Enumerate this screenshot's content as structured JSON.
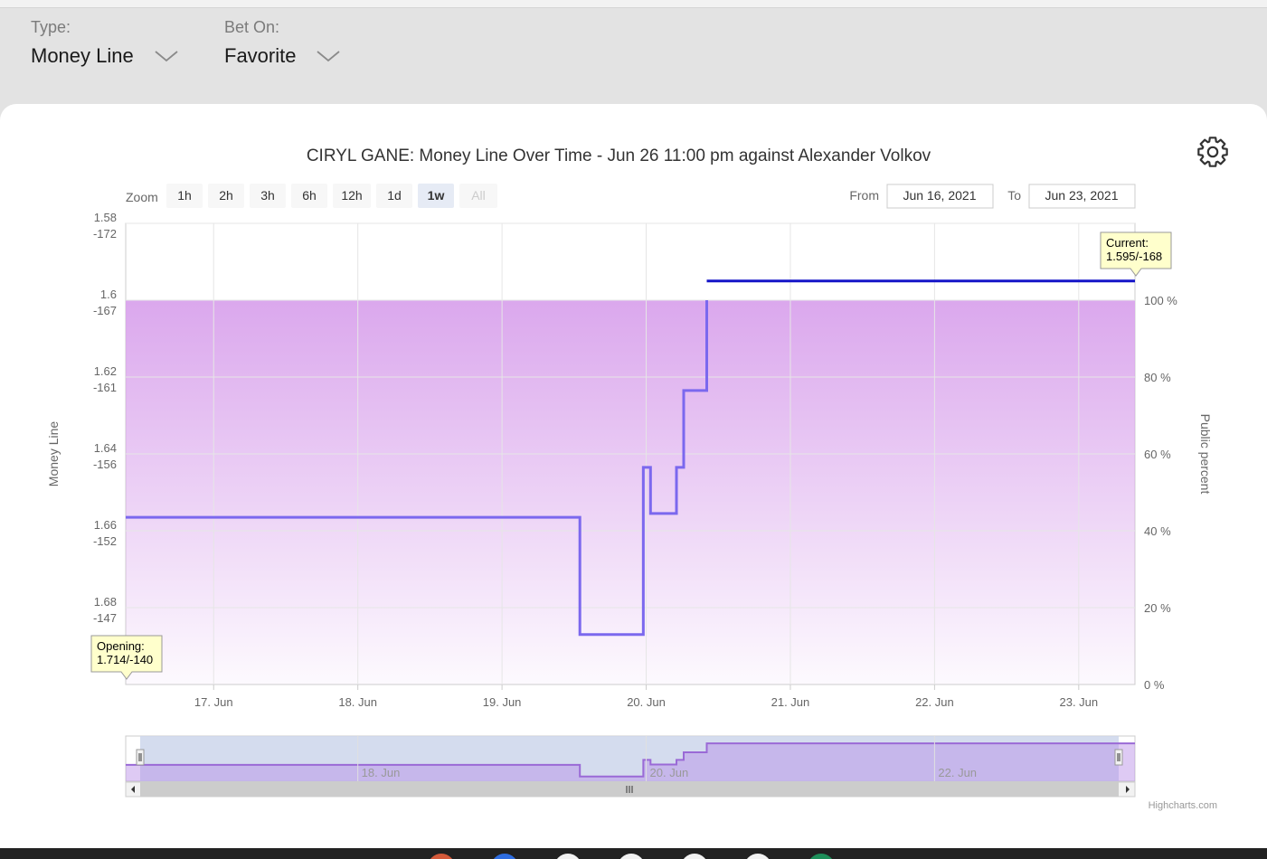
{
  "filters": {
    "type": {
      "label": "Type:",
      "value": "Money Line"
    },
    "bet_on": {
      "label": "Bet On:",
      "value": "Favorite"
    }
  },
  "chart_data": {
    "type": "line",
    "title": "CIRYL GANE: Money Line Over Time - Jun 26 11:00 pm against Alexander Volkov",
    "ylabel": "Money Line",
    "y2label": "Public percent",
    "x_ticks": [
      "17. Jun",
      "18. Jun",
      "19. Jun",
      "20. Jun",
      "21. Jun",
      "22. Jun",
      "23. Jun"
    ],
    "x_range_days": [
      16.39,
      23.39
    ],
    "y_range_decimal": [
      1.7,
      1.58
    ],
    "y_ticks": [
      {
        "decimal": 1.58,
        "american": "-172"
      },
      {
        "decimal": 1.6,
        "american": "-167"
      },
      {
        "decimal": 1.62,
        "american": "-161"
      },
      {
        "decimal": 1.64,
        "american": "-156"
      },
      {
        "decimal": 1.66,
        "american": "-152"
      },
      {
        "decimal": 1.68,
        "american": "-147"
      }
    ],
    "y2_ticks": [
      "100 %",
      "80 %",
      "60 %",
      "40 %",
      "20 %",
      "0 %"
    ],
    "y2_range": [
      0,
      120
    ],
    "series": [
      {
        "color": "#7b68ee",
        "step": true,
        "x": [
          16.39,
          19.54,
          19.98,
          20.03,
          20.21,
          20.26,
          20.42
        ],
        "y": [
          1.6565,
          1.687,
          1.6435,
          1.6555,
          1.6435,
          1.6235,
          1.6
        ]
      },
      {
        "color": "#1515c8",
        "step": true,
        "x": [
          20.42,
          23.39
        ],
        "y": [
          1.595,
          1.595
        ]
      }
    ],
    "public_percent_area": {
      "value": 100,
      "color": "#d9a3ec"
    },
    "annotations": {
      "opening": {
        "line1": "Opening:",
        "line2": "1.714/-140"
      },
      "current": {
        "line1": "Current:",
        "line2": "1.595/-168"
      }
    },
    "range_selector": {
      "zoom_label": "Zoom",
      "buttons": [
        "1h",
        "2h",
        "3h",
        "6h",
        "12h",
        "1d",
        "1w",
        "All"
      ],
      "selected": "1w",
      "disabled": "All",
      "from_label": "From",
      "from_value": "Jun 16, 2021",
      "to_label": "To",
      "to_value": "Jun 23, 2021"
    },
    "navigator_ticks": [
      "18. Jun",
      "20. Jun",
      "22. Jun"
    ],
    "credit": "Highcharts.com"
  },
  "icons": {
    "settings": "gear-icon",
    "dropdown": "chevron-down-icon"
  }
}
